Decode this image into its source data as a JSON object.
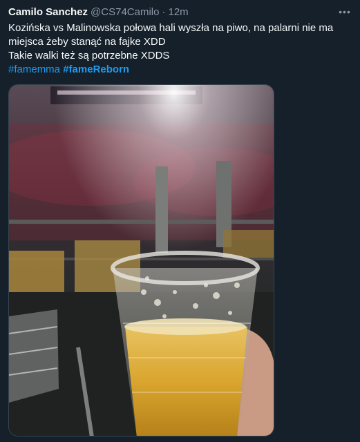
{
  "author": {
    "display_name": "Camilo Sanchez",
    "handle": "@CS74Camilo",
    "separator": "·",
    "time_ago": "12m"
  },
  "more_icon": "more-horizontal-icon",
  "tweet": {
    "lines": [
      "Kozińska vs Malinowska połowa hali wyszła na piwo, na palarni nie ma",
      "miejsca żeby stanąć na fajke XDD",
      "Takie walki też są potrzebne XDDS"
    ],
    "hashtags": [
      "#famemma",
      "#fameReborn"
    ]
  },
  "media": {
    "type": "photo",
    "description_icon": "photo-beer-cup-arena"
  },
  "colors": {
    "background": "#15202b",
    "text": "#f7f9f9",
    "secondary": "#8b98a5",
    "link": "#1d9bf0"
  }
}
